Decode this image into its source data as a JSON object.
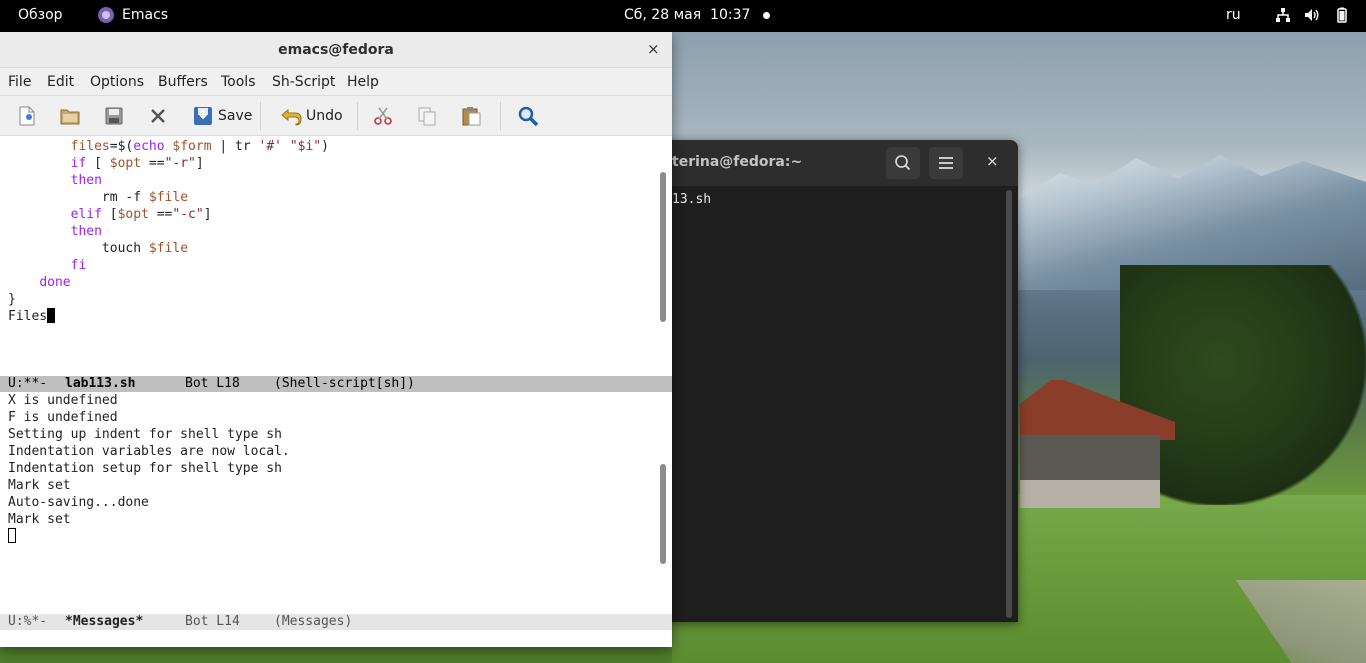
{
  "topbar": {
    "activities": "Обзор",
    "app_name": "Emacs",
    "clock": "Сб, 28 мая  10:37",
    "language": "ru"
  },
  "terminal": {
    "title": "terina@fedora:~",
    "line": "13.sh",
    "close_label": "×"
  },
  "emacs": {
    "title": "emacs@fedora",
    "close_label": "×",
    "menu": [
      "File",
      "Edit",
      "Options",
      "Buffers",
      "Tools",
      "Sh-Script",
      "Help"
    ],
    "toolbar": {
      "save_label": "Save",
      "undo_label": "Undo"
    },
    "code_lines": [
      "files=$(echo $form | tr '#' \"$i\")",
      "if [ $opt ==\"-r\"]",
      "then",
      "rm -f $file",
      "elif [$opt ==\"-c\"]",
      "then",
      "touch $file",
      "fi",
      "done",
      "}",
      "Files"
    ],
    "modeline_top": {
      "status": "U:**-",
      "buffer": "lab113.sh",
      "position": "Bot L18",
      "mode": "(Shell-script[sh])"
    },
    "messages": [
      "X is undefined",
      "F is undefined",
      "Setting up indent for shell type sh",
      "Indentation variables are now local.",
      "Indentation setup for shell type sh",
      "Mark set",
      "Auto-saving...done",
      "Mark set"
    ],
    "modeline_bottom": {
      "status": "U:%*-",
      "buffer": "*Messages*",
      "position": "Bot L14",
      "mode": "(Messages)"
    }
  },
  "colors": {
    "keyword": "#a020f0",
    "variable": "#a0522d",
    "string": "#8b2252"
  }
}
